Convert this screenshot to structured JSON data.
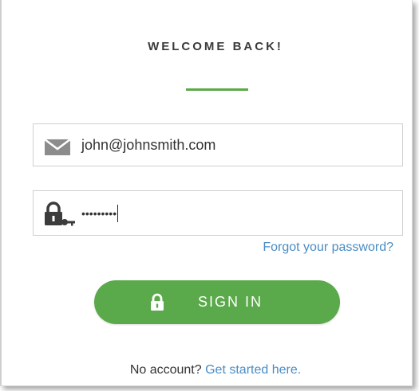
{
  "header": {
    "title": "WELCOME BACK!"
  },
  "form": {
    "email_value": "john@johnsmith.com",
    "email_icon": "envelope-icon",
    "password_value": "•••••••••",
    "password_icon": "lock-key-icon",
    "forgot_link": "Forgot your password?",
    "signin_label": "SIGN IN",
    "signin_icon": "lock-icon"
  },
  "footer": {
    "prompt": "No account?",
    "link": "Get started here."
  },
  "colors": {
    "accent": "#5aa94a",
    "link": "#4a8cc4",
    "text": "#333333"
  }
}
